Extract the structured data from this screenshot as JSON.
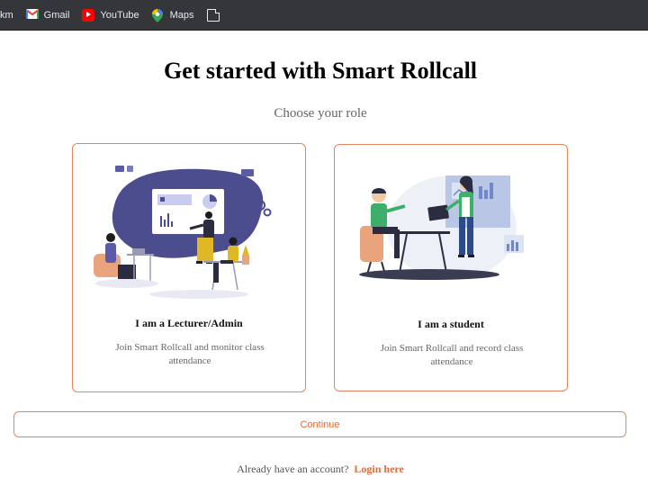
{
  "bookmarks": [
    {
      "label": "km",
      "icon": "folder-icon"
    },
    {
      "label": "Gmail",
      "icon": "gmail-icon"
    },
    {
      "label": "YouTube",
      "icon": "youtube-icon"
    },
    {
      "label": "Maps",
      "icon": "maps-icon"
    },
    {
      "label": "",
      "icon": "document-icon"
    }
  ],
  "page": {
    "title": "Get started with Smart Rollcall",
    "subtitle": "Choose your role"
  },
  "roles": [
    {
      "label": "I am a Lecturer/Admin",
      "description": "Join Smart Rollcall and monitor class attendance",
      "illustration": "lecturer-presentation-illustration"
    },
    {
      "label": "I am a student",
      "description": "Join Smart Rollcall and record class attendance",
      "illustration": "students-laptop-illustration"
    }
  ],
  "actions": {
    "continue_label": "Continue",
    "login_prompt": "Already have an account?",
    "login_link": "Login here"
  },
  "colors": {
    "accent": "#e06b3a",
    "border": "#e8855f",
    "toolbar": "#35363a"
  }
}
